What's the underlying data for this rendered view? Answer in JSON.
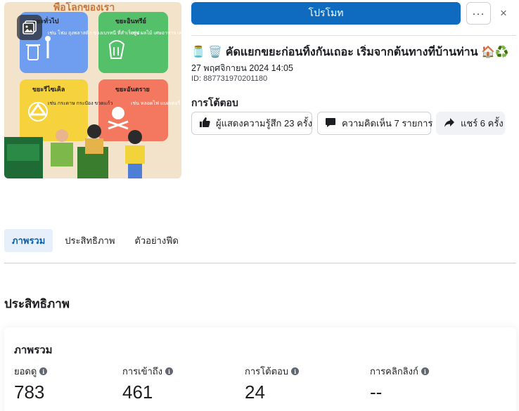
{
  "header": {
    "promote_label": "โปรโมท",
    "more_label": "···",
    "close_label": "×"
  },
  "thumbnail": {
    "top_text": "พื่อโลกของเรา",
    "bins": [
      {
        "title": "ขยะทั่วไป",
        "desc": "เช่น โฟม ถุงพลาสติก ของเบรหนี ที่สำเร็จรูป",
        "color": "#6f9ef0"
      },
      {
        "title": "ขยะอินทรีย์",
        "desc": "เช่น ผลไม้ เศษอาหาร เศษผัก กิ่งไม้ ใบไม้",
        "color": "#54c06a"
      },
      {
        "title": "ขยะรีไซเคิล",
        "desc": "เช่น กระดาษ กระป๋อง ขวดแก้ว",
        "color": "#f6d23c"
      },
      {
        "title": "ขยะอันตราย",
        "desc": "เช่น หลอดไฟ แบตเตอรี่ ยาฆ่าแมลง ถ่านไฟฉาย",
        "color": "#f47860"
      }
    ]
  },
  "post": {
    "title": "🫙 🗑️ คัดแยกขยะก่อนทิ้งกันเถอะ เริ่มจากต้นทางที่บ้านท่าน 🏠♻️",
    "date": "27 พฤศจิกายน 2024 14:05",
    "id": "ID: 887731970201180"
  },
  "reactions": {
    "heading": "การโต้ตอบ",
    "likes_label": "ผู้แสดงความรู้สึก 23 ครั้ง",
    "comments_label": "ความคิดเห็น 7 รายการ",
    "shares_label": "แชร์ 6 ครั้ง"
  },
  "tabs": [
    "ภาพรวม",
    "ประสิทธิภาพ",
    "ตัวอย่างฟีด"
  ],
  "performance": {
    "section_title": "ประสิทธิภาพ",
    "card_title": "ภาพรวม",
    "metrics": [
      {
        "label": "ยอดดู",
        "value": "783"
      },
      {
        "label": "การเข้าถึง",
        "value": "461"
      },
      {
        "label": "การโต้ตอบ",
        "value": "24"
      },
      {
        "label": "การคลิกลิงก์",
        "value": "--"
      }
    ]
  },
  "colors": {
    "accent": "#0f6bc0",
    "tab_active_bg": "#e7f0fa",
    "tab_active_text": "#0f5fa8"
  }
}
